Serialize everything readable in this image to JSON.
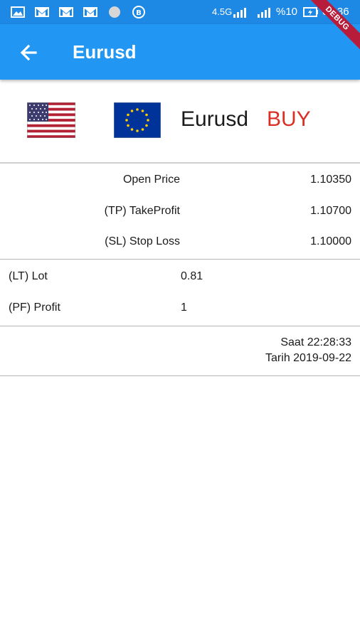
{
  "status_bar": {
    "network": "4.5G",
    "battery_percent": "%10",
    "time": "03:36",
    "icons": [
      "gallery-icon",
      "gmail-icon",
      "gmail-icon",
      "gmail-icon",
      "circle-icon",
      "b-app-icon",
      "signal-icon",
      "battery-charging-icon"
    ]
  },
  "app_bar": {
    "title": "Eurusd",
    "back_icon": "arrow-back-icon",
    "debug_label": "DEBUG",
    "color": "#2196f3"
  },
  "header": {
    "base_flag": "us-flag-icon",
    "quote_flag": "eu-flag-icon",
    "pair": "Eurusd",
    "direction": "BUY",
    "direction_color": "#d93025"
  },
  "prices": [
    {
      "label": "Open Price",
      "value": "1.10350"
    },
    {
      "label": "(TP) TakeProfit",
      "value": "1.10700"
    },
    {
      "label": "(SL) Stop Loss",
      "value": "1.10000"
    }
  ],
  "details": [
    {
      "label": "(LT) Lot",
      "value": "0.81"
    },
    {
      "label": "(PF) Profit",
      "value": "1"
    }
  ],
  "timestamp": {
    "time": "Saat 22:28:33",
    "date": "Tarih 2019-09-22"
  }
}
